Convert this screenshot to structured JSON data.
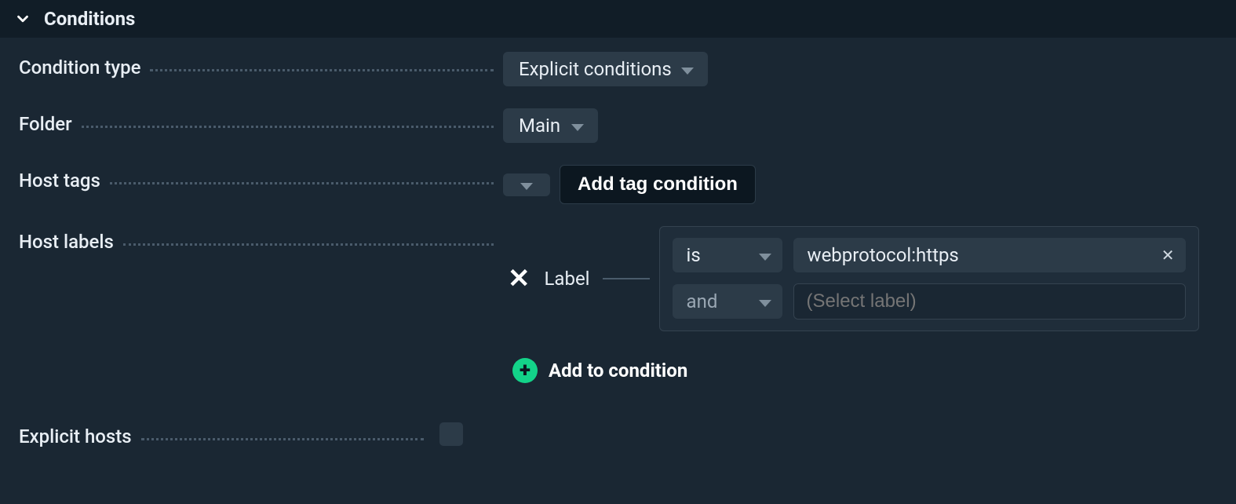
{
  "section_title": "Conditions",
  "fields": {
    "condition_type": {
      "label": "Condition type",
      "value": "Explicit conditions"
    },
    "folder": {
      "label": "Folder",
      "value": "Main"
    },
    "host_tags": {
      "label": "Host tags",
      "button": "Add tag condition"
    },
    "host_labels": {
      "label": "Host labels",
      "caption": "Label",
      "rows": [
        {
          "op": "is",
          "value": "webprotocol:https"
        },
        {
          "op": "and",
          "placeholder": "(Select label)"
        }
      ],
      "add_button": "Add to condition"
    },
    "explicit_hosts": {
      "label": "Explicit hosts",
      "checked": false
    }
  }
}
